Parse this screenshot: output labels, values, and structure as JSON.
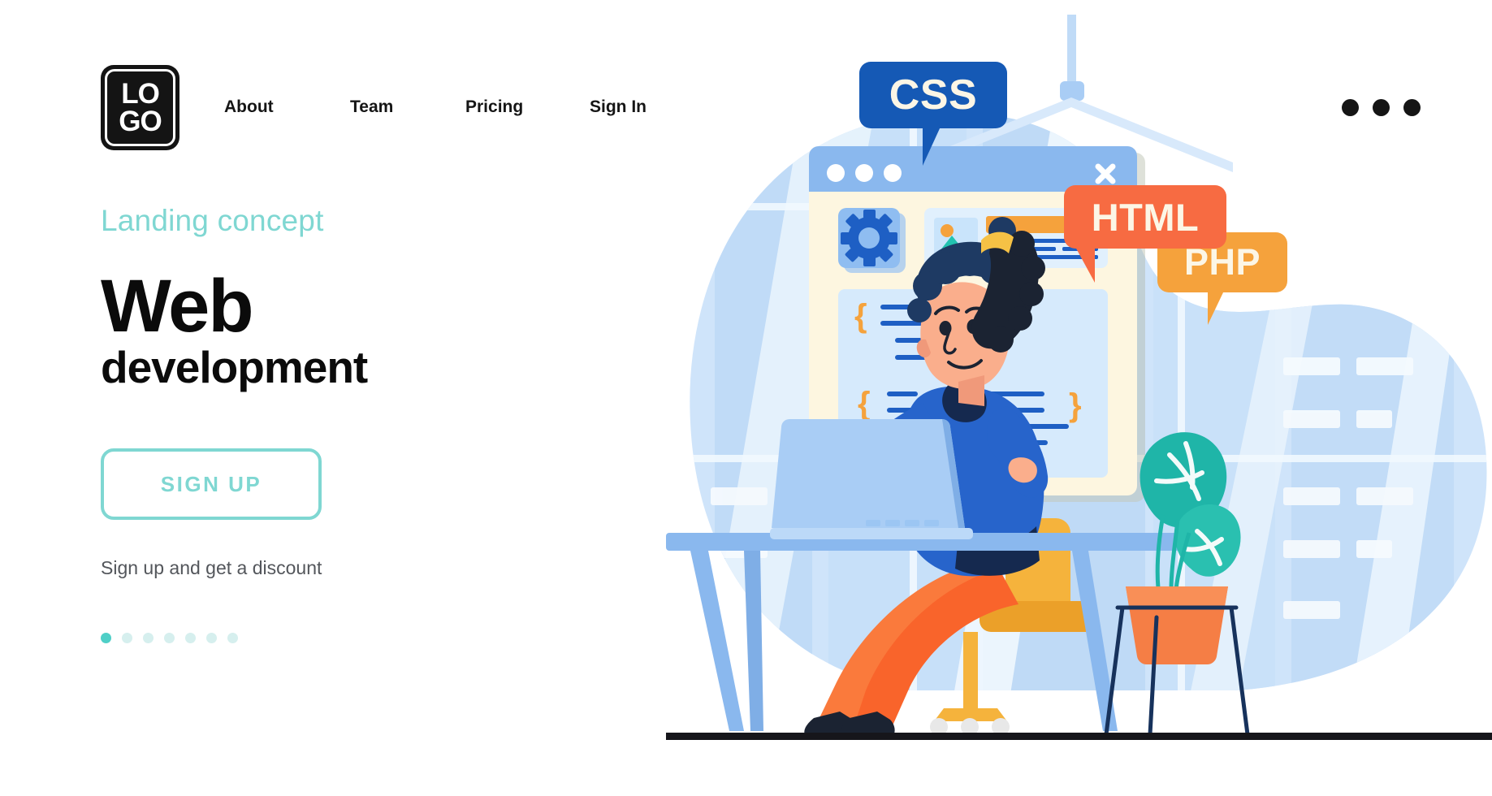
{
  "brand": {
    "logo_line1": "LO",
    "logo_line2": "GO",
    "accent_teal": "#7FD7D2",
    "accent_dark": "#141414"
  },
  "header": {
    "nav": [
      {
        "label": "About"
      },
      {
        "label": "Team"
      },
      {
        "label": "Pricing"
      },
      {
        "label": "Sign In"
      }
    ],
    "more_menu_icon": "ellipsis-horizontal-icon"
  },
  "hero": {
    "eyebrow": "Landing concept",
    "title_line1": "Web",
    "title_line2": "development",
    "cta_label": "SIGN UP",
    "subnote": "Sign up and get a discount",
    "pagination": {
      "count": 7,
      "active_index": 0,
      "active_color": "#4FCFC7",
      "inactive_color": "#D6EFEE"
    }
  },
  "illustration": {
    "name": "web-development-scene",
    "browser_window": {
      "titlebar_color": "#8AB8EE",
      "body_color": "#FDF6E0",
      "dots": 3,
      "close_icon": "close-x-icon",
      "widgets": [
        {
          "name": "gear-icon-tile",
          "icon": "gear-icon",
          "color": "#1E5FC4"
        },
        {
          "name": "image-card",
          "icon": "image-icon",
          "heading_bar_color": "#F5A23C"
        }
      ],
      "code_block": {
        "brace_color": "#F5A23C",
        "line_color": "#1E5FC4"
      }
    },
    "bubbles": [
      {
        "label": "CSS",
        "color": "#1559B5",
        "shadow": "#0C3F86",
        "text_color": "#FCF6E6"
      },
      {
        "label": "PHP",
        "color": "#F5A23C",
        "shadow": "#E0654E",
        "text_color": "#FCF6E6"
      },
      {
        "label": "HTML",
        "color": "#F76B42",
        "shadow": "#E0503A",
        "text_color": "#FCF6E6"
      }
    ],
    "character": {
      "name": "woman-developer",
      "hair_color": "#1E3A63",
      "hair_tie_color": "#F5C145",
      "skin_color": "#FAAE8C",
      "sweater_color": "#2764CB",
      "pants_color": "#FA7A3C",
      "shoe_color": "#1B2332"
    },
    "furniture": {
      "desk_color": "#8AB8EE",
      "laptop_color": "#A9CDF5",
      "chair_color": "#F5B33C",
      "plant_pot_color": "#F57E45",
      "plant_leaf_color": "#1FB5A8",
      "floor_line_color": "#16161b"
    },
    "background_blob_color": "#CFE4FA"
  }
}
